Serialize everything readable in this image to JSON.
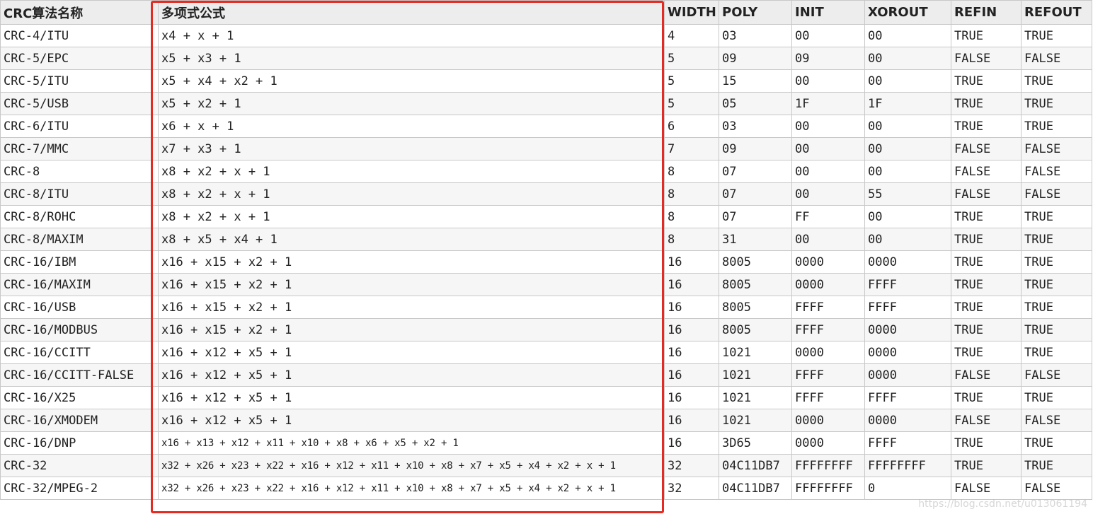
{
  "headers": [
    "CRC算法名称",
    "多项式公式",
    "WIDTH",
    "POLY",
    "INIT",
    "XOROUT",
    "REFIN",
    "REFOUT"
  ],
  "rows": [
    [
      "CRC-4/ITU",
      "x4 + x + 1",
      "4",
      "03",
      "00",
      "00",
      "TRUE",
      "TRUE"
    ],
    [
      "CRC-5/EPC",
      "x5 + x3 + 1",
      "5",
      "09",
      "09",
      "00",
      "FALSE",
      "FALSE"
    ],
    [
      "CRC-5/ITU",
      "x5 + x4 + x2 + 1",
      "5",
      "15",
      "00",
      "00",
      "TRUE",
      "TRUE"
    ],
    [
      "CRC-5/USB",
      "x5 + x2 + 1",
      "5",
      "05",
      "1F",
      "1F",
      "TRUE",
      "TRUE"
    ],
    [
      "CRC-6/ITU",
      "x6 + x + 1",
      "6",
      "03",
      "00",
      "00",
      "TRUE",
      "TRUE"
    ],
    [
      "CRC-7/MMC",
      "x7 + x3 + 1",
      "7",
      "09",
      "00",
      "00",
      "FALSE",
      "FALSE"
    ],
    [
      "CRC-8",
      "x8 + x2 + x + 1",
      "8",
      "07",
      "00",
      "00",
      "FALSE",
      "FALSE"
    ],
    [
      "CRC-8/ITU",
      "x8 + x2 + x + 1",
      "8",
      "07",
      "00",
      "55",
      "FALSE",
      "FALSE"
    ],
    [
      "CRC-8/ROHC",
      "x8 + x2 + x + 1",
      "8",
      "07",
      "FF",
      "00",
      "TRUE",
      "TRUE"
    ],
    [
      "CRC-8/MAXIM",
      "x8 + x5 + x4 + 1",
      "8",
      "31",
      "00",
      "00",
      "TRUE",
      "TRUE"
    ],
    [
      "CRC-16/IBM",
      "x16 + x15 + x2 + 1",
      "16",
      "8005",
      "0000",
      "0000",
      "TRUE",
      "TRUE"
    ],
    [
      "CRC-16/MAXIM",
      "x16 + x15 + x2 + 1",
      "16",
      "8005",
      "0000",
      "FFFF",
      "TRUE",
      "TRUE"
    ],
    [
      "CRC-16/USB",
      "x16 + x15 + x2 + 1",
      "16",
      "8005",
      "FFFF",
      "FFFF",
      "TRUE",
      "TRUE"
    ],
    [
      "CRC-16/MODBUS",
      "x16 + x15 + x2 + 1",
      "16",
      "8005",
      "FFFF",
      "0000",
      "TRUE",
      "TRUE"
    ],
    [
      "CRC-16/CCITT",
      "x16 + x12 + x5 + 1",
      "16",
      "1021",
      "0000",
      "0000",
      "TRUE",
      "TRUE"
    ],
    [
      "CRC-16/CCITT-FALSE",
      "x16 + x12 + x5 + 1",
      "16",
      "1021",
      "FFFF",
      "0000",
      "FALSE",
      "FALSE"
    ],
    [
      "CRC-16/X25",
      "x16 + x12 + x5 + 1",
      "16",
      "1021",
      "FFFF",
      "FFFF",
      "TRUE",
      "TRUE"
    ],
    [
      "CRC-16/XMODEM",
      "x16 + x12 + x5 + 1",
      "16",
      "1021",
      "0000",
      "0000",
      "FALSE",
      "FALSE"
    ],
    [
      "CRC-16/DNP",
      "x16 + x13 + x12 + x11 + x10 + x8 + x6 + x5 + x2 + 1",
      "16",
      "3D65",
      "0000",
      "FFFF",
      "TRUE",
      "TRUE"
    ],
    [
      "CRC-32",
      "x32 + x26 + x23 + x22 + x16 + x12 + x11 + x10 + x8 + x7 + x5 + x4 + x2 + x + 1",
      "32",
      "04C11DB7",
      "FFFFFFFF",
      "FFFFFFFF",
      "TRUE",
      "TRUE"
    ],
    [
      "CRC-32/MPEG-2",
      "x32 + x26 + x23 + x22 + x16 + x12 + x11 + x10 + x8 + x7 + x5 + x4 + x2 + x + 1",
      "32",
      "04C11DB7",
      "FFFFFFFF",
      "0",
      "FALSE",
      "FALSE"
    ]
  ],
  "highlight": {
    "color": "#e52a22",
    "column": "多项式公式"
  },
  "watermark": "https://blog.csdn.net/u013061194"
}
